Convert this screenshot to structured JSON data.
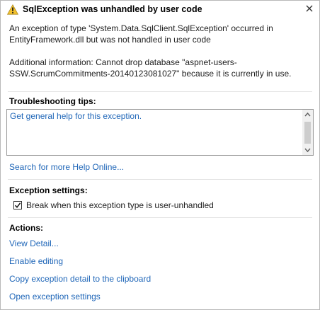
{
  "dialog": {
    "title": "SqlException was unhandled by user code",
    "title_icon": "warning-icon",
    "close_icon": "close-icon",
    "message_line1": "An exception of type 'System.Data.SqlClient.SqlException' occurred in",
    "message_line2": "EntityFramework.dll but was not handled in user code",
    "additional_line1": "Additional information: Cannot drop database \"aspnet-users-",
    "additional_line2": "SSW.ScrumCommitments-20140123081027\" because it is currently in use."
  },
  "troubleshooting": {
    "heading": "Troubleshooting tips:",
    "tips": [
      "Get general help for this exception."
    ],
    "search_link": "Search for more Help Online..."
  },
  "exception_settings": {
    "heading": "Exception settings:",
    "checkbox_label": "Break when this exception type is user-unhandled",
    "checked": true
  },
  "actions": {
    "heading": "Actions:",
    "items": [
      "View Detail...",
      "Enable editing",
      "Copy exception detail to the clipboard",
      "Open exception settings"
    ]
  },
  "colors": {
    "link": "#1f66b8",
    "warning": "#f2c12e"
  }
}
